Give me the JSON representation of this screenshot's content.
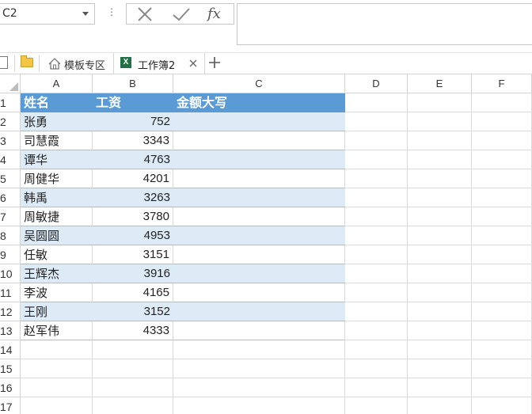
{
  "formula_bar": {
    "name_box_value": "C2",
    "dots": "⋮",
    "cancel_icon": "cancel-x-icon",
    "enter_icon": "checkmark-icon",
    "function_label": "fx",
    "formula_value": ""
  },
  "tabs": {
    "template_tab_label": "模板专区",
    "workbook_tab_label": "工作簿2",
    "workbook_icon_letter": "X"
  },
  "sheet": {
    "columns": [
      "A",
      "B",
      "C",
      "D",
      "E",
      "F"
    ],
    "rows": [
      "1",
      "2",
      "3",
      "4",
      "5",
      "6",
      "7",
      "8",
      "9",
      "10",
      "11",
      "12",
      "13",
      "14",
      "15",
      "16",
      "17"
    ],
    "header_row": {
      "name": "姓名",
      "salary": "工资",
      "amount_upper": "金额大写"
    },
    "records": [
      {
        "name": "张勇",
        "salary": "752"
      },
      {
        "name": "司慧霞",
        "salary": "3343"
      },
      {
        "name": "谭华",
        "salary": "4763"
      },
      {
        "name": "周健华",
        "salary": "4201"
      },
      {
        "name": "韩禹",
        "salary": "3263"
      },
      {
        "name": "周敏捷",
        "salary": "3780"
      },
      {
        "name": "吴圆圆",
        "salary": "4953"
      },
      {
        "name": "任敏",
        "salary": "3151"
      },
      {
        "name": "王辉杰",
        "salary": "3916"
      },
      {
        "name": "李波",
        "salary": "4165"
      },
      {
        "name": "王刚",
        "salary": "3152"
      },
      {
        "name": "赵军伟",
        "salary": "4333"
      }
    ],
    "colors": {
      "header_fill": "#5b9bd5",
      "band_fill": "#ddebf7",
      "band_border": "#9bc2e6"
    }
  }
}
